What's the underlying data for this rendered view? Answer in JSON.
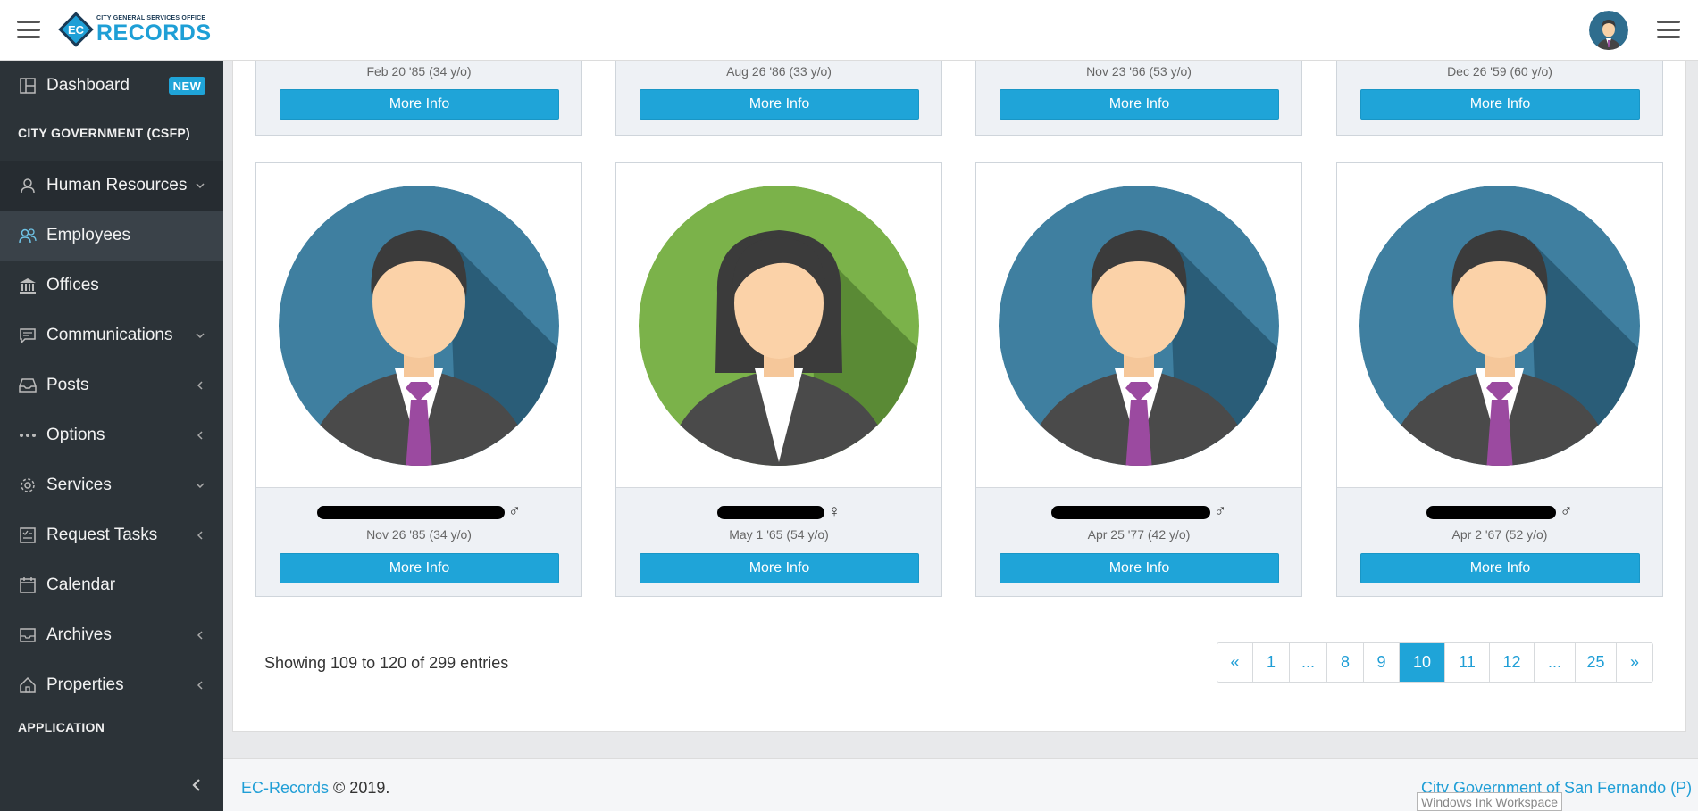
{
  "header": {
    "logo_small_text": "CITY GENERAL SERVICES OFFICE",
    "logo_big_text": "RECORDS",
    "logo_badge_text": "EC"
  },
  "sidebar": {
    "dashboard": {
      "label": "Dashboard",
      "badge": "NEW"
    },
    "section_city": "CITY GOVERNMENT (CSFP)",
    "items": [
      {
        "label": "Human Resources",
        "icon": "user-icon",
        "arrow": "down"
      },
      {
        "label": "Employees",
        "icon": "users-icon",
        "arrow": ""
      },
      {
        "label": "Offices",
        "icon": "bank-icon",
        "arrow": ""
      },
      {
        "label": "Communications",
        "icon": "chat-icon",
        "arrow": "down"
      },
      {
        "label": "Posts",
        "icon": "inbox-icon",
        "arrow": "left"
      },
      {
        "label": "Options",
        "icon": "dots-icon",
        "arrow": "left"
      },
      {
        "label": "Services",
        "icon": "gear-icon",
        "arrow": "down"
      },
      {
        "label": "Request Tasks",
        "icon": "checklist-icon",
        "arrow": "left"
      },
      {
        "label": "Calendar",
        "icon": "calendar-icon",
        "arrow": ""
      },
      {
        "label": "Archives",
        "icon": "archive-icon",
        "arrow": "left"
      },
      {
        "label": "Properties",
        "icon": "home-icon",
        "arrow": "left"
      }
    ],
    "section_app": "APPLICATION"
  },
  "cards_top": [
    {
      "date": "Feb 20 '85 (34 y/o)",
      "button": "More Info"
    },
    {
      "date": "Aug 26 '86 (33 y/o)",
      "button": "More Info"
    },
    {
      "date": "Nov 23 '66 (53 y/o)",
      "button": "More Info"
    },
    {
      "date": "Dec 26 '59 (60 y/o)",
      "button": "More Info"
    }
  ],
  "cards": [
    {
      "gender_symbol": "♂",
      "avatar": "male",
      "date": "Nov 26 '85 (34 y/o)",
      "button": "More Info"
    },
    {
      "gender_symbol": "♀",
      "avatar": "female",
      "date": "May 1 '65 (54 y/o)",
      "button": "More Info"
    },
    {
      "gender_symbol": "♂",
      "avatar": "male",
      "date": "Apr 25 '77 (42 y/o)",
      "button": "More Info"
    },
    {
      "gender_symbol": "♂",
      "avatar": "male",
      "date": "Apr 2 '67 (52 y/o)",
      "button": "More Info"
    }
  ],
  "entries_text": "Showing 109 to 120 of 299 entries",
  "pagination": [
    "«",
    "1",
    "...",
    "8",
    "9",
    "10",
    "11",
    "12",
    "...",
    "25",
    "»"
  ],
  "pagination_active": "10",
  "footer": {
    "brand": "EC-Records",
    "copyright": "© 2019.",
    "right": "City Government of San Fernando (P)"
  },
  "tooltip": "Windows Ink Workspace",
  "colors": {
    "accent": "#1fa4d8",
    "sidebar_bg": "#2c3338",
    "male_avatar": "#3f7fa0",
    "female_avatar": "#7bb24a"
  }
}
